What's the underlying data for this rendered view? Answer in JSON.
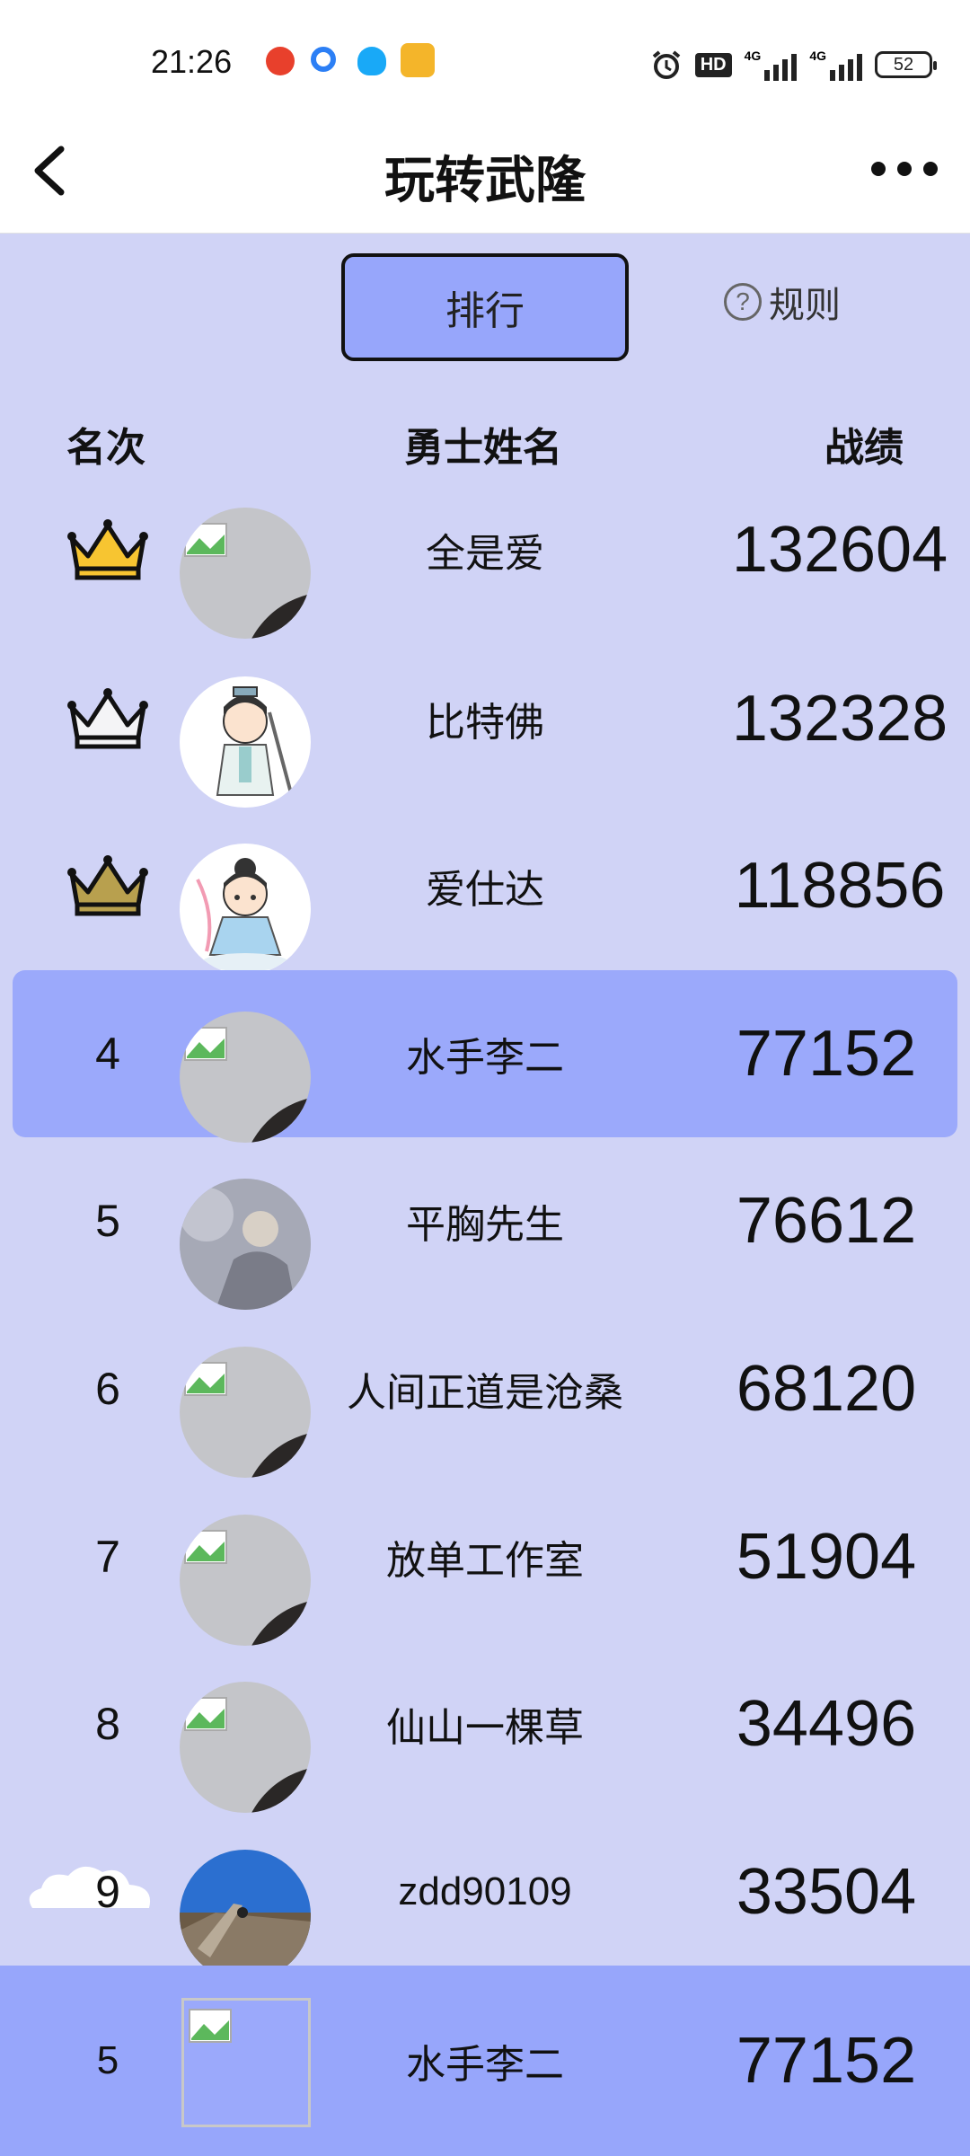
{
  "status_bar": {
    "time": "21:26",
    "network_badge": "HD",
    "signal_1": "4G",
    "signal_2": "4G",
    "battery": "52",
    "icons": [
      "weibo-icon",
      "browser-icon",
      "qq-icon",
      "game-app-icon",
      "alarm-icon",
      "hd-icon",
      "signal-icon",
      "signal-icon",
      "battery-icon"
    ]
  },
  "header": {
    "title": "玩转武隆",
    "back_icon": "chevron-left-icon",
    "more_icon": "more-dots-icon"
  },
  "tabs": {
    "rank_label": "排行",
    "rules_label": "规则",
    "rules_icon": "question-circle-icon"
  },
  "columns": {
    "rank": "名次",
    "name": "勇士姓名",
    "score": "战绩"
  },
  "rows": [
    {
      "rank": "1",
      "crown": "gold",
      "name": "全是爱",
      "score": "132604",
      "avatar": "broken-image"
    },
    {
      "rank": "2",
      "crown": "silver",
      "name": "比特佛",
      "score": "132328",
      "avatar": "cartoon-swordsman"
    },
    {
      "rank": "3",
      "crown": "bronze",
      "name": "爱仕达",
      "score": "118856",
      "avatar": "cartoon-fairy"
    },
    {
      "rank": "4",
      "name": "水手李二",
      "score": "77152",
      "avatar": "broken-image",
      "highlight": true
    },
    {
      "rank": "5",
      "name": "平胸先生",
      "score": "76612",
      "avatar": "photo"
    },
    {
      "rank": "6",
      "name": "人间正道是沧桑",
      "score": "68120",
      "avatar": "broken-image"
    },
    {
      "rank": "7",
      "name": "放单工作室",
      "score": "51904",
      "avatar": "broken-image"
    },
    {
      "rank": "8",
      "name": "仙山一棵草",
      "score": "34496",
      "avatar": "broken-image"
    },
    {
      "rank": "9",
      "name": "zdd90109",
      "score": "33504",
      "avatar": "great-wall-photo"
    }
  ],
  "my_rank": {
    "rank": "5",
    "name": "水手李二",
    "score": "77152",
    "avatar": "broken-image"
  },
  "colors": {
    "page_bg": "#d0d3f6",
    "highlight": "#9ba9fb",
    "tab_bg": "#97a6fb",
    "gold_crown": "#f7c531",
    "silver_crown": "#f4f4f6",
    "bronze_crown": "#b8a04e"
  }
}
